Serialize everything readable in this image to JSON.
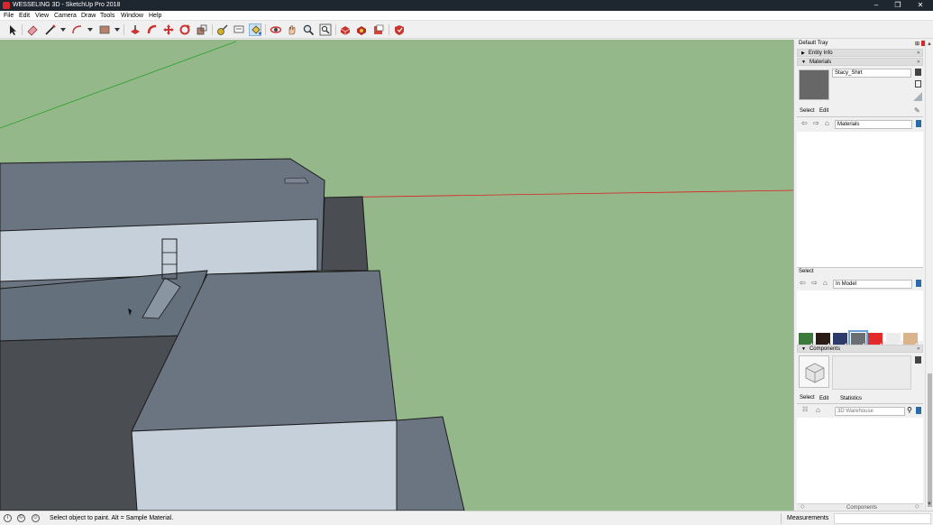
{
  "window": {
    "title": "WESSELING 3D - SketchUp Pro 2018",
    "minimize_glyph": "–",
    "restore_glyph": "❐",
    "close_glyph": "✕"
  },
  "menu": [
    "File",
    "Edit",
    "View",
    "Camera",
    "Draw",
    "Tools",
    "Window",
    "Help"
  ],
  "toolbar": {
    "tools": [
      "select",
      "eraser",
      "line",
      "arc",
      "rectangle",
      "push-pull",
      "follow-me",
      "move",
      "rotate",
      "scale",
      "tape-measure",
      "text",
      "paint-bucket",
      "orbit",
      "pan",
      "zoom",
      "zoom-extents",
      "3d-warehouse",
      "extension-warehouse",
      "layout",
      "extension-manager"
    ],
    "active_tool": "paint-bucket"
  },
  "tray": {
    "title": "Default Tray",
    "entity_info_label": "Entity Info",
    "materials_label": "Materials",
    "material_name": "Stacy_Shirt",
    "material_preview_color": "#676767",
    "tabs_top": [
      "Select",
      "Edit"
    ],
    "library_top": "Materials",
    "select_label": "Select",
    "library_bottom": "In Model",
    "swatches": [
      {
        "color": "#3d7a3c"
      },
      {
        "color": "#2a1c16"
      },
      {
        "color": "#2d3b6a"
      },
      {
        "color": "#6b6e72",
        "selected": true
      },
      {
        "color": "#e22a2a"
      },
      {
        "color": "#ececec"
      },
      {
        "color": "#d9b48c"
      }
    ],
    "components_label": "Components",
    "components_tabs": [
      "Select",
      "Edit",
      "Statistics"
    ],
    "search_placeholder": "3D Warehouse",
    "components_footer": "Components"
  },
  "status": {
    "message": "Select object to paint. Alt = Sample Material.",
    "measurements_label": "Measurements"
  }
}
